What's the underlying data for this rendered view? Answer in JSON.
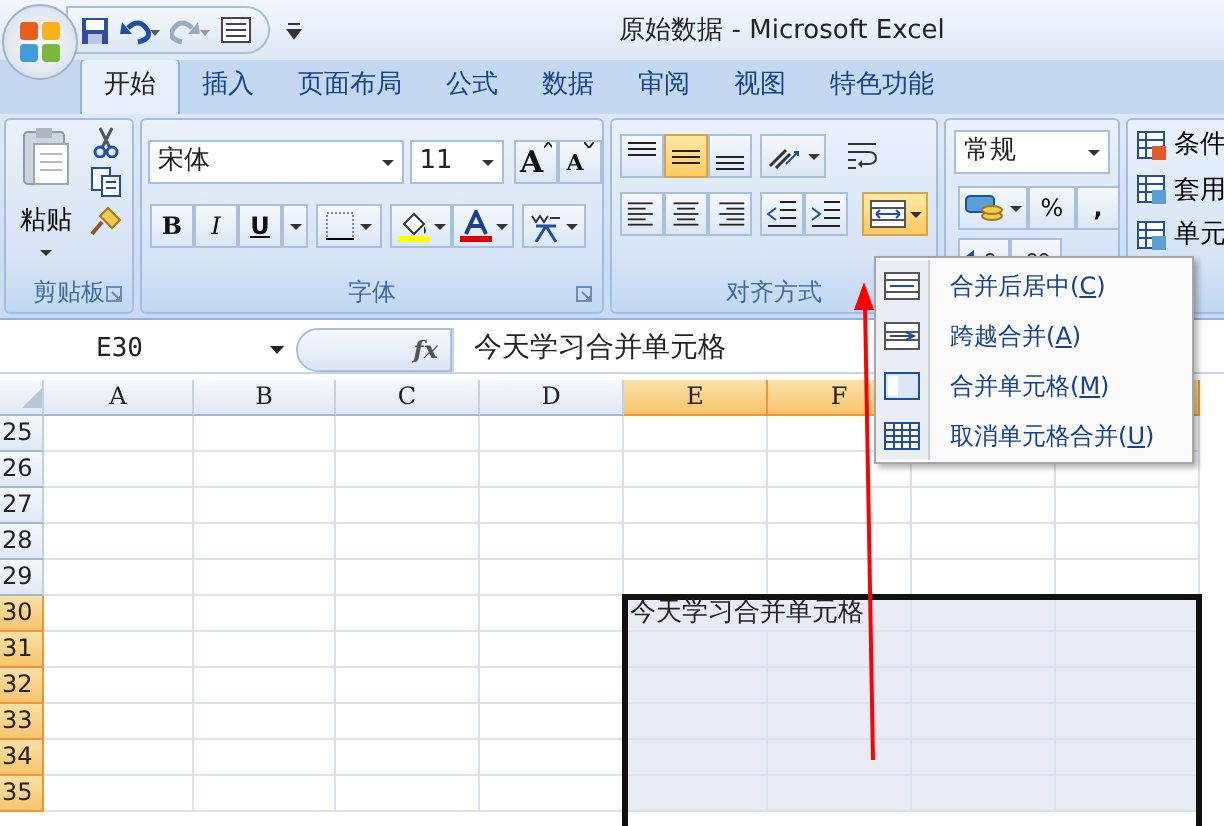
{
  "window": {
    "title": "原始数据 - Microsoft Excel"
  },
  "tabs": [
    {
      "label": "开始",
      "selected": true
    },
    {
      "label": "插入",
      "selected": false
    },
    {
      "label": "页面布局",
      "selected": false
    },
    {
      "label": "公式",
      "selected": false
    },
    {
      "label": "数据",
      "selected": false
    },
    {
      "label": "审阅",
      "selected": false
    },
    {
      "label": "视图",
      "selected": false
    },
    {
      "label": "特色功能",
      "selected": false
    }
  ],
  "ribbon": {
    "clipboard": {
      "label": "剪贴板",
      "paste": "粘贴"
    },
    "font": {
      "label": "字体",
      "font_name": "宋体",
      "font_size": "11",
      "grow": "A",
      "shrink": "A",
      "bold": "B",
      "italic": "I",
      "underline": "U"
    },
    "alignment": {
      "label": "对齐方式",
      "vertical": [
        {
          "selected": false
        },
        {
          "selected": true
        },
        {
          "selected": false
        }
      ],
      "merge_open": true
    },
    "number": {
      "format": "常规",
      "percent": "%",
      "comma": ","
    },
    "styles": {
      "items": [
        "条件",
        "套用",
        "单元"
      ]
    }
  },
  "formula_bar": {
    "name_box": "E30",
    "fx": "fx",
    "content": "今天学习合并单元格"
  },
  "sheet": {
    "columns": [
      {
        "label": "A",
        "selected": false
      },
      {
        "label": "B",
        "selected": false
      },
      {
        "label": "C",
        "selected": false
      },
      {
        "label": "D",
        "selected": false
      },
      {
        "label": "E",
        "selected": true
      },
      {
        "label": "F",
        "selected": true
      },
      {
        "selected": true
      },
      {
        "selected": true
      }
    ],
    "rows": [
      {
        "label": "25",
        "selected": false
      },
      {
        "label": "26",
        "selected": false
      },
      {
        "label": "27",
        "selected": false
      },
      {
        "label": "28",
        "selected": false
      },
      {
        "label": "29",
        "selected": false
      },
      {
        "label": "30",
        "selected": true,
        "cells": {
          "E": "今天学习合并单元格"
        }
      },
      {
        "label": "31",
        "selected": true
      },
      {
        "label": "32",
        "selected": true
      },
      {
        "label": "33",
        "selected": true
      },
      {
        "label": "34",
        "selected": true
      },
      {
        "label": "35",
        "selected": true
      }
    ]
  },
  "merge_menu": [
    {
      "kind": "merge-center",
      "before": "合并后居中(",
      "key": "C",
      "after": ")"
    },
    {
      "kind": "merge-across",
      "before": "跨越合并(",
      "key": "A",
      "after": ")"
    },
    {
      "kind": "merge-cells",
      "before": "合并单元格(",
      "key": "M",
      "after": ")"
    },
    {
      "kind": "unmerge",
      "before": "取消单元格合并(",
      "key": "U",
      "after": ")"
    }
  ]
}
